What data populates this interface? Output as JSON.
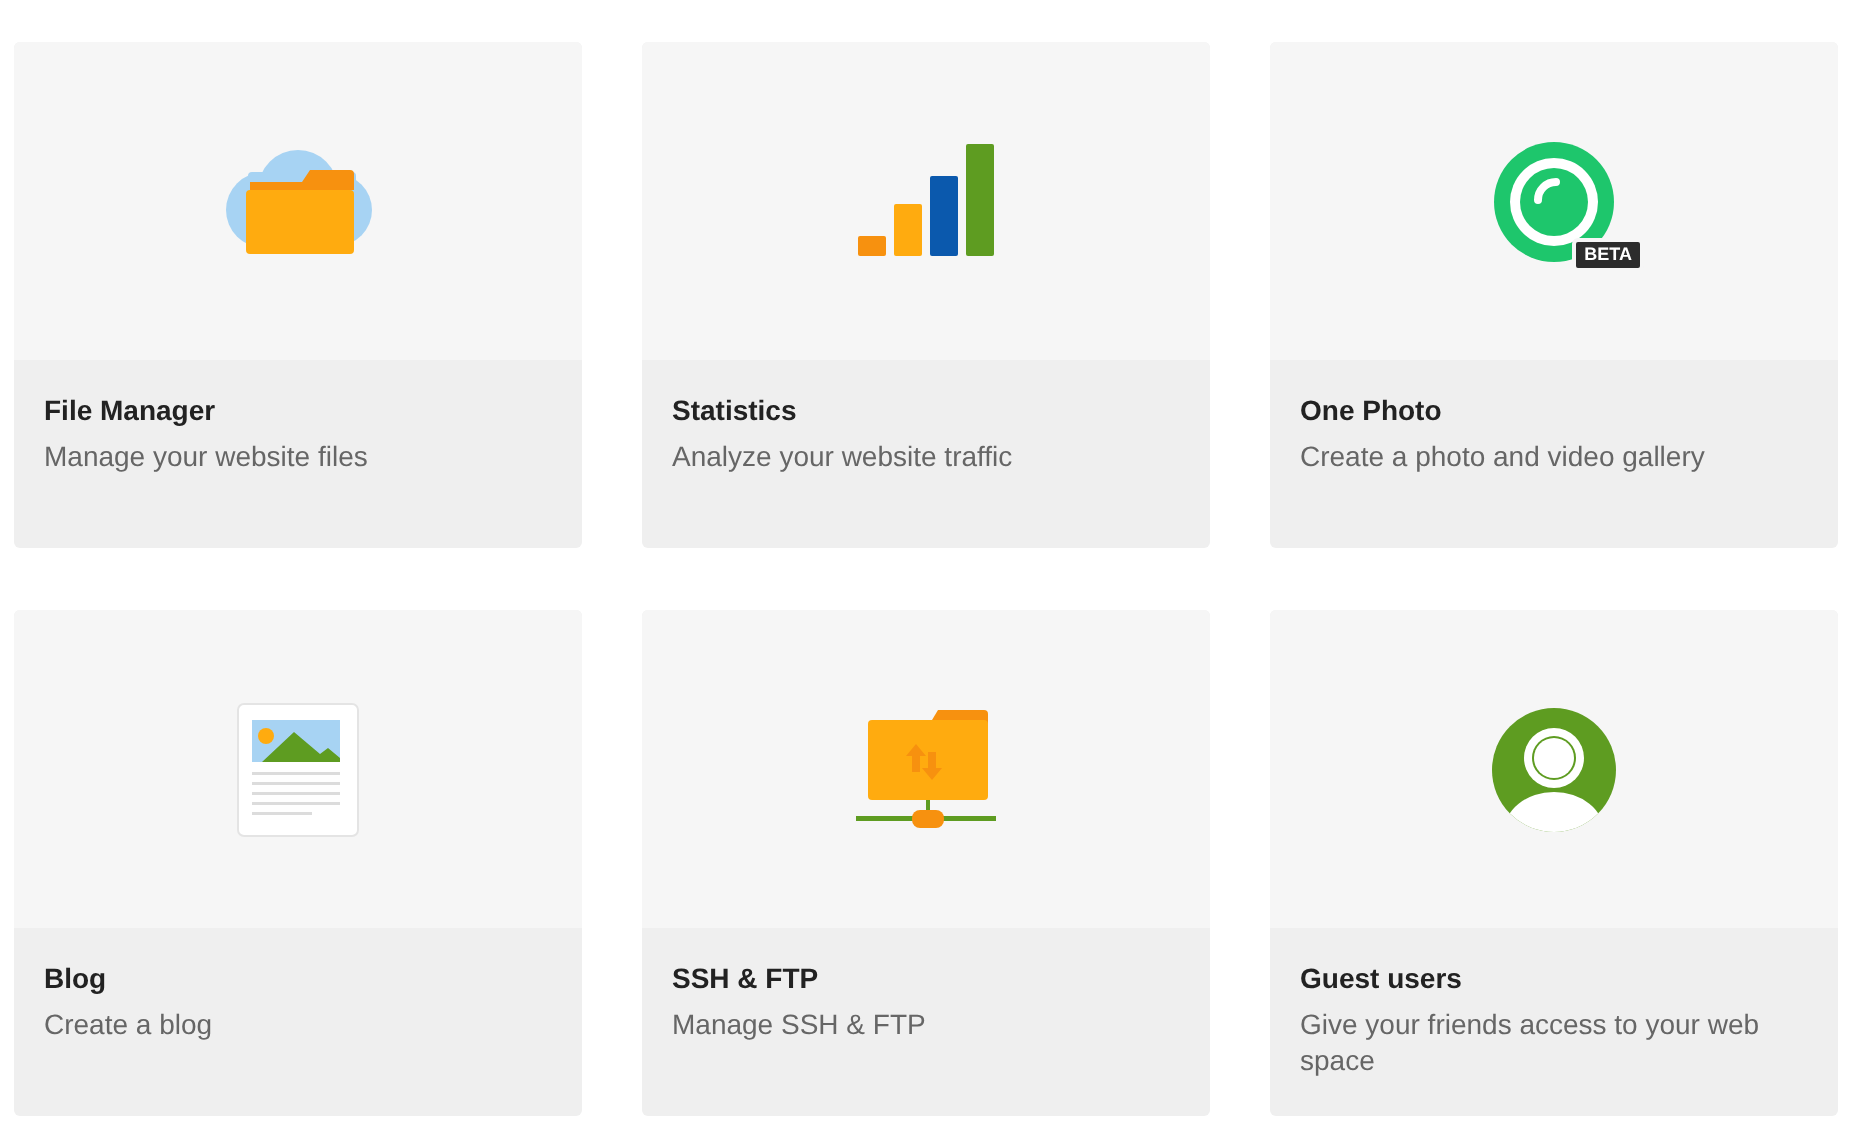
{
  "tiles": [
    {
      "kind": "cloud-folder",
      "title": "File Manager",
      "description": "Manage your website files"
    },
    {
      "kind": "bar-chart",
      "title": "Statistics",
      "description": "Analyze your website traffic"
    },
    {
      "kind": "camera-lens",
      "badge": "BETA",
      "title": "One Photo",
      "description": "Create a photo and video gallery"
    },
    {
      "kind": "document",
      "title": "Blog",
      "description": "Create a blog"
    },
    {
      "kind": "network-folder",
      "title": "SSH & FTP",
      "description": "Manage SSH & FTP"
    },
    {
      "kind": "user",
      "title": "Guest users",
      "description": "Give your friends access to your web space"
    }
  ]
}
